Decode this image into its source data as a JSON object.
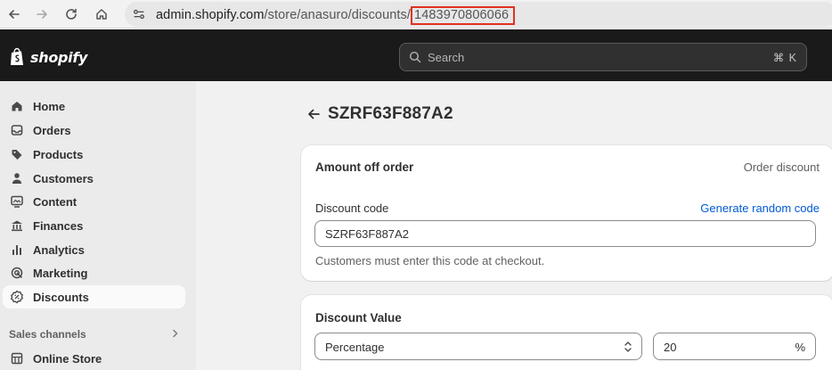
{
  "browser": {
    "url_prefix": "admin.shopify.com",
    "url_path": "/store/anasuro/discounts/",
    "url_id": "1483970806066"
  },
  "header": {
    "logo_text": "shopify",
    "search_placeholder": "Search",
    "search_shortcut": "⌘ K"
  },
  "sidebar": {
    "items": [
      {
        "label": "Home",
        "icon": "home-icon"
      },
      {
        "label": "Orders",
        "icon": "inbox-icon"
      },
      {
        "label": "Products",
        "icon": "tag-icon"
      },
      {
        "label": "Customers",
        "icon": "person-icon"
      },
      {
        "label": "Content",
        "icon": "image-icon"
      },
      {
        "label": "Finances",
        "icon": "bank-icon"
      },
      {
        "label": "Analytics",
        "icon": "bar-chart-icon"
      },
      {
        "label": "Marketing",
        "icon": "target-icon"
      },
      {
        "label": "Discounts",
        "icon": "discount-icon",
        "active": true
      }
    ],
    "section_label": "Sales channels",
    "channels": [
      {
        "label": "Online Store",
        "icon": "store-icon"
      }
    ]
  },
  "page": {
    "title": "SZRF63F887A2"
  },
  "discount_card": {
    "title": "Amount off order",
    "meta": "Order discount",
    "code_label": "Discount code",
    "generate_link": "Generate random code",
    "code_value": "SZRF63F887A2",
    "help_text": "Customers must enter this code at checkout."
  },
  "value_card": {
    "title": "Discount Value",
    "type_selected": "Percentage",
    "amount_value": "20",
    "amount_suffix": "%"
  },
  "colors": {
    "header_bg": "#1a1a1a",
    "sidebar_bg": "#ebebeb",
    "link": "#005bd3",
    "highlight": "#e0321f"
  }
}
